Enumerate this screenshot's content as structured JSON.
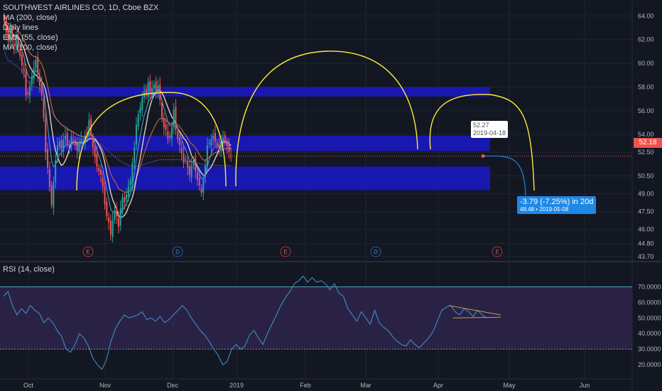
{
  "header": {
    "title": "SOUTHWEST AIRLINES CO, 1D, Cboe BZX",
    "indicators": [
      "MA (200, close)",
      "Daily lines",
      "EMA (55, close)",
      "MA (100, close)"
    ]
  },
  "last_price_label": "52.18",
  "projection": {
    "main": "-3.79 (-7.25%) in 20d",
    "sub": "48.48 • 2019-05-08"
  },
  "hover_label": {
    "price": "52.27",
    "date": "2019-04-18"
  },
  "rsi": {
    "title": "RSI (14, close)"
  },
  "colors": {
    "background": "#131722",
    "up": "#26a69a",
    "down": "#ef5350",
    "zone": "#1a18c9",
    "ma200": "#4a3aa0",
    "ema55": "#b5653c",
    "ma100": "#d9d2c0",
    "ma_short": "#4fa3d8",
    "pattern": "#ffeb3b",
    "rsi_line": "#3d8cc7",
    "rsi_band": "#3a2a5e",
    "projection": "#1e88e5"
  },
  "chart_data": [
    {
      "type": "candlestick",
      "title": "SOUTHWEST AIRLINES CO, 1D, Cboe BZX",
      "ylim": [
        43.7,
        64.5
      ],
      "y_ticks": [
        "64.00",
        "62.00",
        "60.00",
        "58.00",
        "56.00",
        "54.00",
        "52.50",
        "50.50",
        "49.00",
        "47.50",
        "46.00",
        "44.80",
        "43.70"
      ],
      "x_ticks": [
        "Oct",
        "Nov",
        "Dec",
        "2019",
        "Feb",
        "Mar",
        "Apr",
        "May",
        "Jun"
      ],
      "closes": [
        63.6,
        62.6,
        61.9,
        62.8,
        61.9,
        61.4,
        62.1,
        61.3,
        60.6,
        59.8,
        59.3,
        57.3,
        57.4,
        58.1,
        58.9,
        59.6,
        60.3,
        59.1,
        58.1,
        57.3,
        55.4,
        52.5,
        51.2,
        49.6,
        48.1,
        50.0,
        51.8,
        53.1,
        53.4,
        52.8,
        53.6,
        53.9,
        53.2,
        53.0,
        53.8,
        53.5,
        53.1,
        52.6,
        53.2,
        53.6,
        53.4,
        53.9,
        54.1,
        55.2,
        53.9,
        52.9,
        52.1,
        51.3,
        50.9,
        50.6,
        49.6,
        48.1,
        47.1,
        46.6,
        45.6,
        46.8,
        47.6,
        47.1,
        46.2,
        47.8,
        48.7,
        48.3,
        48.9,
        49.6,
        50.1,
        51.6,
        52.9,
        54.8,
        55.7,
        56.3,
        57.1,
        57.6,
        57.3,
        58.4,
        57.5,
        57.9,
        58.2,
        57.7,
        58.1,
        56.9,
        55.4,
        54.6,
        54.4,
        53.6,
        53.9,
        54.6,
        56.1,
        54.4,
        53.6,
        53.1,
        52.4,
        51.6,
        51.9,
        51.2,
        50.6,
        51.4,
        51.8,
        50.9,
        50.2,
        49.7,
        49.1,
        50.2,
        51.4,
        53.1,
        53.3,
        53.6,
        53.9,
        53.4,
        53.1,
        52.9,
        53.4,
        53.7,
        53.4,
        53.0,
        52.5,
        52.18
      ],
      "horizontal_zones": [
        [
          57.2,
          58.0
        ],
        [
          52.6,
          53.9
        ],
        [
          49.3,
          51.3
        ]
      ],
      "events": [
        {
          "label": "E",
          "date": "Oct"
        },
        {
          "label": "D",
          "date": "Dec"
        },
        {
          "label": "E",
          "date": "Jan"
        },
        {
          "label": "D",
          "date": "Mar"
        },
        {
          "label": "E",
          "date": "Apr"
        }
      ],
      "last_price": 52.18,
      "projection": {
        "change": -3.79,
        "percent": -7.25,
        "days": 20,
        "target": 48.48,
        "target_date": "2019-05-08"
      }
    },
    {
      "type": "line",
      "title": "RSI (14, close)",
      "ylim": [
        15,
        78
      ],
      "y_ticks": [
        "70.0000",
        "60.0000",
        "50.0000",
        "40.0000",
        "30.0000",
        "20.0000"
      ],
      "levels": [
        70,
        30
      ],
      "values": [
        64,
        67,
        58,
        52,
        56,
        53,
        58,
        55,
        53,
        47,
        50,
        47,
        42,
        38,
        30,
        28,
        33,
        40,
        37,
        32,
        24,
        20,
        17,
        23,
        35,
        43,
        48,
        52,
        50,
        51,
        52,
        54,
        49,
        50,
        48,
        51,
        47,
        49,
        52,
        55,
        58,
        55,
        50,
        46,
        42,
        39,
        35,
        30,
        26,
        20,
        22,
        30,
        33,
        30,
        32,
        39,
        42,
        37,
        33,
        40,
        46,
        52,
        58,
        63,
        67,
        72,
        74,
        77,
        73,
        76,
        73,
        74,
        72,
        68,
        72,
        66,
        64,
        56,
        52,
        48,
        54,
        50,
        46,
        55,
        47,
        44,
        42,
        38,
        35,
        33,
        32,
        36,
        33,
        31,
        34,
        37,
        41,
        48,
        55,
        57,
        58,
        54,
        52,
        56,
        54,
        51,
        55,
        52,
        50
      ]
    }
  ]
}
